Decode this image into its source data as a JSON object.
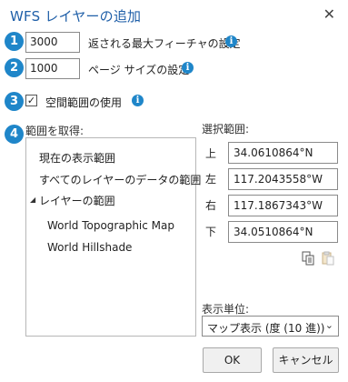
{
  "dialog": {
    "title": "WFS レイヤーの追加",
    "close_glyph": "✕"
  },
  "badges": [
    "1",
    "2",
    "3",
    "4"
  ],
  "rows": {
    "max_features": {
      "value": "3000",
      "label": "返される最大フィーチャの設定"
    },
    "page_size": {
      "value": "1000",
      "label": "ページ サイズの設定"
    },
    "spatial_extent": {
      "checked": true,
      "label": "空間範囲の使用"
    }
  },
  "info_glyph": "i",
  "extent_source": {
    "heading": "範囲を取得:",
    "items": [
      "現在の表示範囲",
      "すべてのレイヤーのデータの範囲",
      "レイヤーの範囲",
      "World Topographic Map",
      "World Hillshade"
    ]
  },
  "selected_extent": {
    "heading": "選択範囲:",
    "top_label": "上",
    "top_value": "34.0610864°N",
    "left_label": "左",
    "left_value": "117.2043558°W",
    "right_label": "右",
    "right_value": "117.1867343°W",
    "bottom_label": "下",
    "bottom_value": "34.0510864°N"
  },
  "icons": {
    "copy": "copy-icon",
    "paste": "paste-icon",
    "info": "info-icon",
    "expand": "triangle-expanded-icon",
    "dropdown": "chevron-down-icon"
  },
  "display_units": {
    "heading": "表示単位:",
    "selected": "マップ表示 (度 (10 進))"
  },
  "footer": {
    "ok_label": "OK",
    "cancel_label": "キャンセル"
  },
  "colors": {
    "accent": "#1f86c9",
    "title": "#1f5fa8"
  }
}
